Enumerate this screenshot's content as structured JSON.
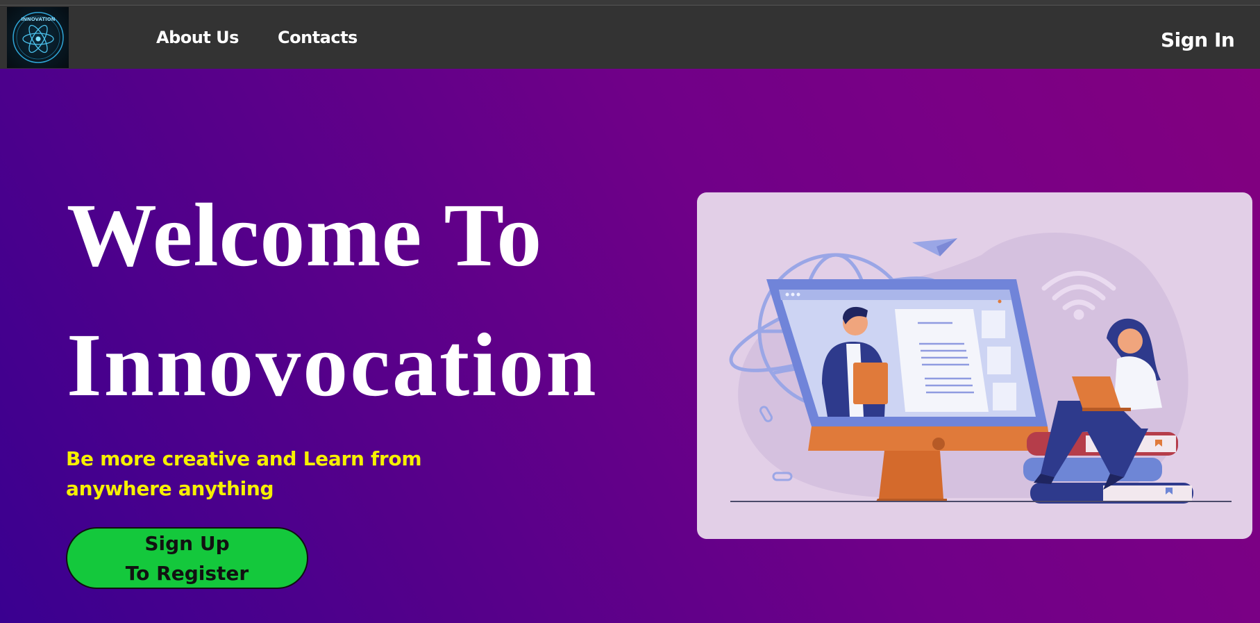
{
  "nav": {
    "logo_text": "INNOVATION",
    "links": [
      {
        "label": "About Us"
      },
      {
        "label": "Contacts"
      }
    ],
    "signin_label": "Sign In"
  },
  "hero": {
    "title_line1": "Welcome To",
    "title_line2": "Innovocation",
    "tagline": "Be more creative and Learn from anywhere anything",
    "signup_line1": "Sign Up",
    "signup_line2": "To Register"
  },
  "colors": {
    "nav_bg": "#333333",
    "accent_yellow": "#f6f000",
    "button_green": "#14c83c",
    "gradient_start": "#3a0090",
    "gradient_end": "#82007f",
    "card_bg": "#e2cfe7"
  },
  "icons": [
    "atom-logo-icon",
    "globe-icon",
    "paper-plane-icon",
    "wifi-icon",
    "monitor-illustration",
    "person-with-clipboard",
    "woman-with-laptop",
    "books-stack"
  ]
}
